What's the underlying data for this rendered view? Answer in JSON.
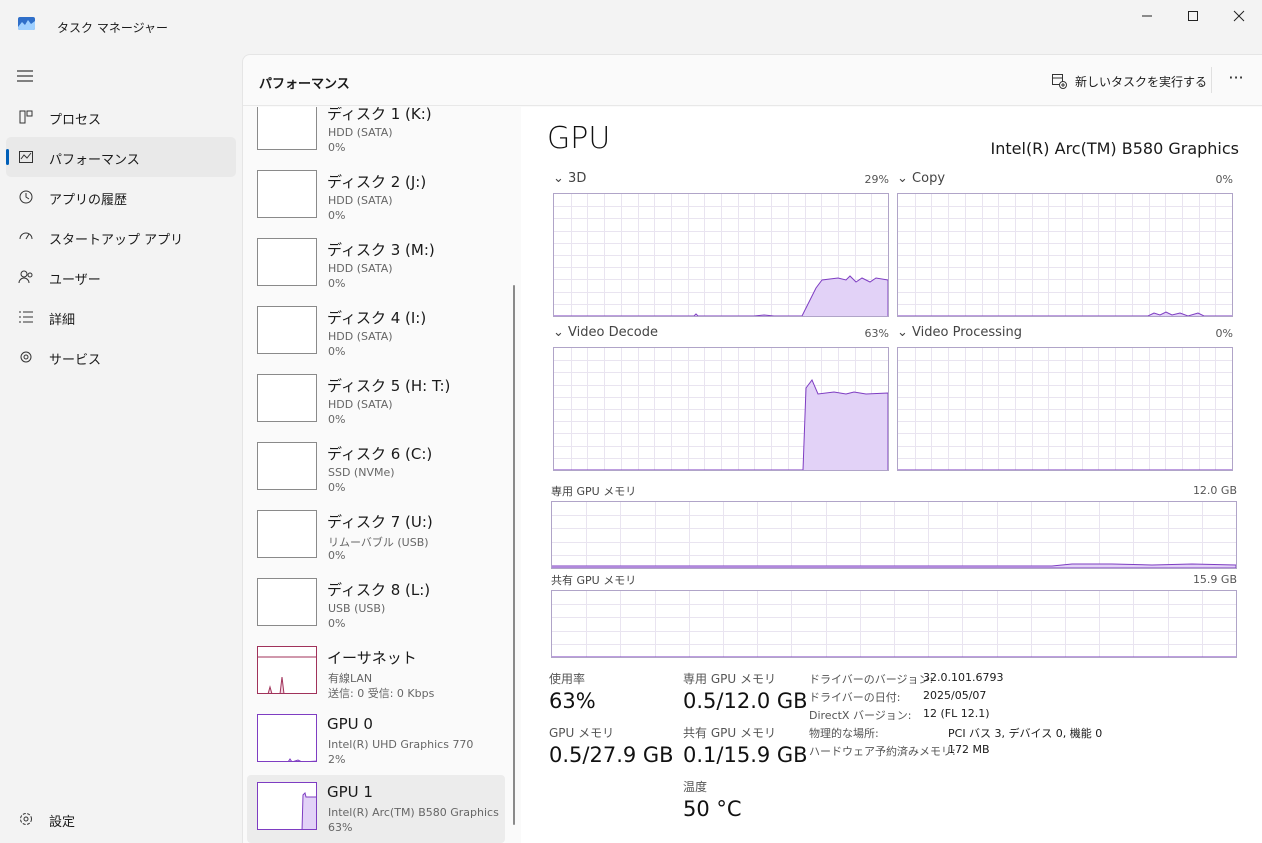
{
  "window": {
    "title": "タスク マネージャー"
  },
  "nav": {
    "items": [
      {
        "label": "プロセス",
        "icon": "processes-icon"
      },
      {
        "label": "パフォーマンス",
        "icon": "performance-icon"
      },
      {
        "label": "アプリの履歴",
        "icon": "history-icon"
      },
      {
        "label": "スタートアップ アプリ",
        "icon": "startup-icon"
      },
      {
        "label": "ユーザー",
        "icon": "users-icon"
      },
      {
        "label": "詳細",
        "icon": "details-icon"
      },
      {
        "label": "サービス",
        "icon": "services-icon"
      }
    ],
    "settings_label": "設定"
  },
  "header": {
    "title": "パフォーマンス",
    "run_task_label": "新しいタスクを実行する",
    "more_label": "···"
  },
  "list": [
    {
      "name": "ディスク 1 (K:)",
      "sub": "HDD (SATA)",
      "value": "0%"
    },
    {
      "name": "ディスク 2 (J:)",
      "sub": "HDD (SATA)",
      "value": "0%"
    },
    {
      "name": "ディスク 3 (M:)",
      "sub": "HDD (SATA)",
      "value": "0%"
    },
    {
      "name": "ディスク 4 (I:)",
      "sub": "HDD (SATA)",
      "value": "0%"
    },
    {
      "name": "ディスク 5 (H: T:)",
      "sub": "HDD (SATA)",
      "value": "0%"
    },
    {
      "name": "ディスク 6 (C:)",
      "sub": "SSD (NVMe)",
      "value": "0%"
    },
    {
      "name": "ディスク 7 (U:)",
      "sub": "リムーバブル (USB)",
      "value": "0%"
    },
    {
      "name": "ディスク 8 (L:)",
      "sub": "USB (USB)",
      "value": "0%"
    },
    {
      "name": "イーサネット",
      "sub": "有線LAN",
      "value": "送信: 0 受信: 0 Kbps"
    },
    {
      "name": "GPU 0",
      "sub": "Intel(R) UHD Graphics 770",
      "value": "2%"
    },
    {
      "name": "GPU 1",
      "sub": "Intel(R) Arc(TM) B580 Graphics",
      "value": "63%"
    }
  ],
  "detail": {
    "title": "GPU",
    "model": "Intel(R) Arc(TM) B580 Graphics",
    "engines": [
      {
        "label": "3D",
        "percent": "29%"
      },
      {
        "label": "Copy",
        "percent": "0%"
      },
      {
        "label": "Video Decode",
        "percent": "63%"
      },
      {
        "label": "Video Processing",
        "percent": "0%"
      }
    ],
    "dedicated_mem": {
      "label": "専用 GPU メモリ",
      "max": "12.0 GB"
    },
    "shared_mem": {
      "label": "共有 GPU メモリ",
      "max": "15.9 GB"
    },
    "stats": {
      "utilization": {
        "label": "使用率",
        "value": "63%"
      },
      "gpu_memory": {
        "label": "GPU メモリ",
        "value": "0.5/27.9 GB"
      },
      "dedicated": {
        "label": "専用 GPU メモリ",
        "value": "0.5/12.0 GB"
      },
      "shared": {
        "label": "共有 GPU メモリ",
        "value": "0.1/15.9 GB"
      },
      "temperature": {
        "label": "温度",
        "value": "50 °C"
      }
    },
    "info": [
      {
        "key": "ドライバーのバージョン:",
        "value": "32.0.101.6793"
      },
      {
        "key": "ドライバーの日付:",
        "value": "2025/05/07"
      },
      {
        "key": "DirectX バージョン:",
        "value": "12 (FL 12.1)"
      },
      {
        "key": "物理的な場所:",
        "value": "PCI バス 3, デバイス 0, 機能 0"
      },
      {
        "key": "ハードウェア予約済みメモリ:",
        "value": "172 MB"
      }
    ]
  },
  "colors": {
    "accent": "#005fb8",
    "gpu_line": "#7e3dc2",
    "gpu_fill": "#e2d2f7",
    "grid": "#e9e4f0"
  }
}
